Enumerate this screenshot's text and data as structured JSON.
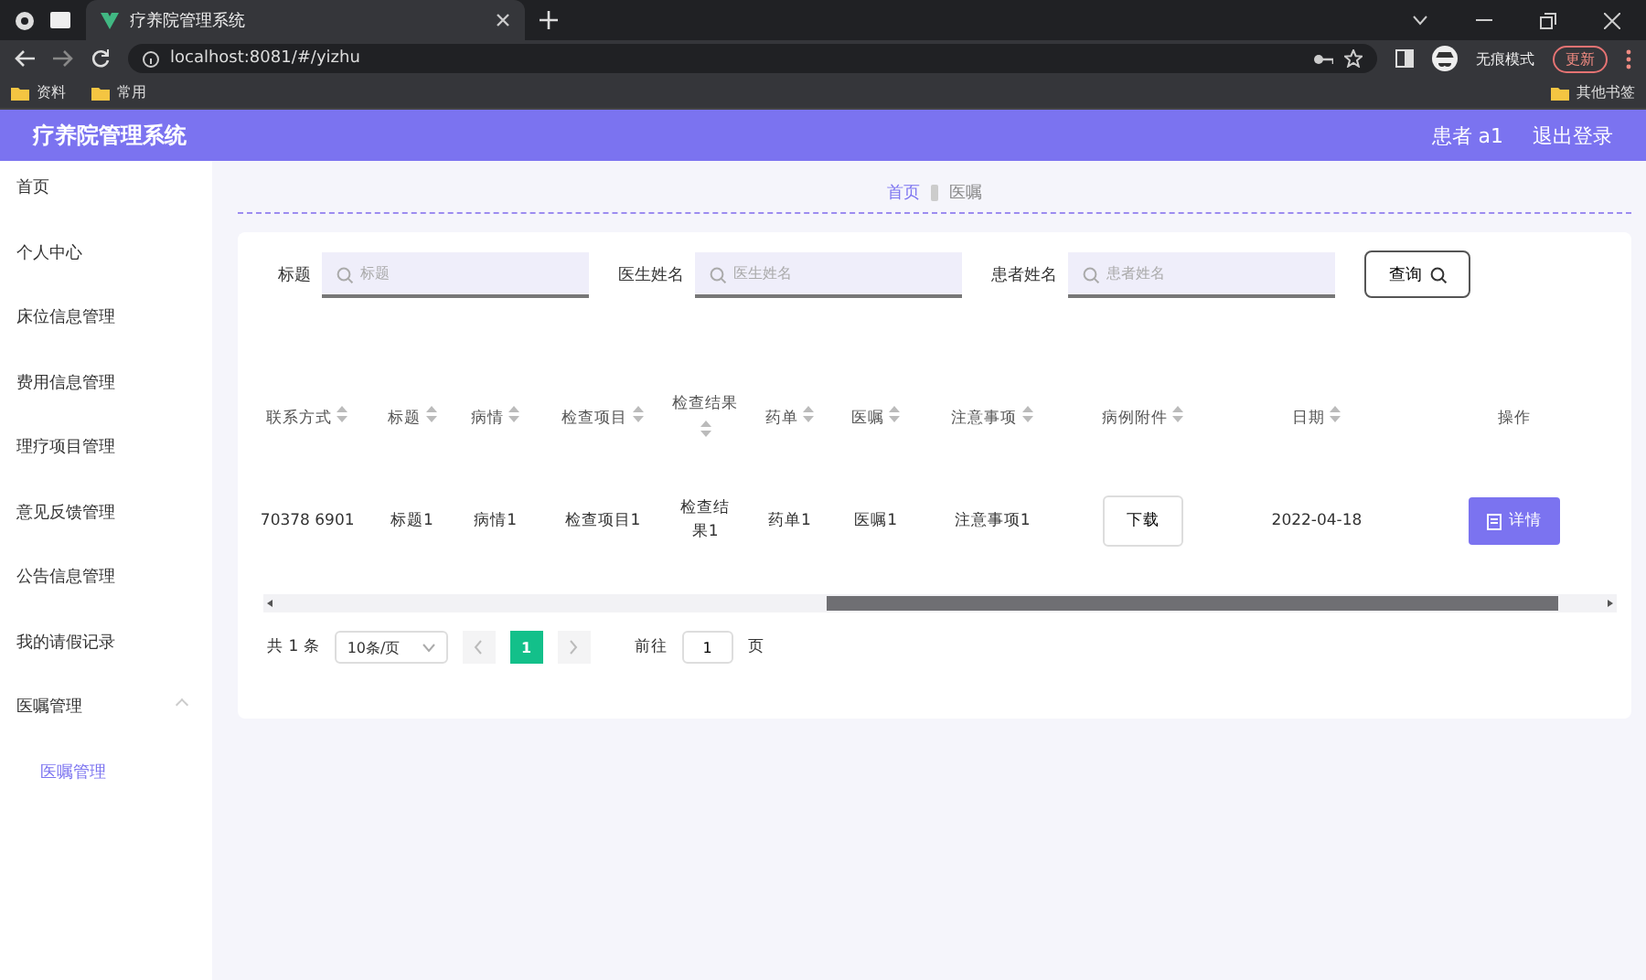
{
  "browser": {
    "tab_title": "疗养院管理系统",
    "url": "localhost:8081/#/yizhu",
    "incognito_label": "无痕模式",
    "update_button": "更新",
    "bookmarks": [
      "资料",
      "常用"
    ],
    "other_bookmarks": "其他书签"
  },
  "header": {
    "title": "疗养院管理系统",
    "user": "患者 a1",
    "logout": "退出登录"
  },
  "sidebar": {
    "items": [
      {
        "label": "首页",
        "selected": false
      },
      {
        "label": "个人中心",
        "selected": false
      },
      {
        "label": "床位信息管理",
        "selected": false
      },
      {
        "label": "费用信息管理",
        "selected": false
      },
      {
        "label": "理疗项目管理",
        "selected": false
      },
      {
        "label": "意见反馈管理",
        "selected": false
      },
      {
        "label": "公告信息管理",
        "selected": false
      },
      {
        "label": "我的请假记录",
        "selected": false
      },
      {
        "label": "医嘱管理",
        "selected": false,
        "expanded": true,
        "children": [
          {
            "label": "医嘱管理",
            "selected": true
          }
        ]
      }
    ]
  },
  "breadcrumb": [
    "首页",
    "医嘱"
  ],
  "search": {
    "fields": [
      {
        "label": "标题",
        "placeholder": "标题"
      },
      {
        "label": "医生姓名",
        "placeholder": "医生姓名"
      },
      {
        "label": "患者姓名",
        "placeholder": "患者姓名"
      }
    ],
    "button": "查询"
  },
  "table": {
    "columns": [
      {
        "label": "联系方式",
        "sortable": true
      },
      {
        "label": "标题",
        "sortable": true
      },
      {
        "label": "病情",
        "sortable": true
      },
      {
        "label": "检查项目",
        "sortable": true
      },
      {
        "label": "检查结果",
        "sortable": true
      },
      {
        "label": "药单",
        "sortable": true
      },
      {
        "label": "医嘱",
        "sortable": true
      },
      {
        "label": "注意事项",
        "sortable": true
      },
      {
        "label": "病例附件",
        "sortable": true
      },
      {
        "label": "日期",
        "sortable": true
      },
      {
        "label": "操作",
        "sortable": false
      }
    ],
    "rows": [
      {
        "cells": [
          {
            "kind": "text",
            "text": "70378 6901"
          },
          {
            "kind": "text",
            "text": "标题1"
          },
          {
            "kind": "text",
            "text": "病情1"
          },
          {
            "kind": "text",
            "text": "检查项目1"
          },
          {
            "kind": "text",
            "text": "检查结果1"
          },
          {
            "kind": "text",
            "text": "药单1"
          },
          {
            "kind": "text",
            "text": "医嘱1"
          },
          {
            "kind": "text",
            "text": "注意事项1"
          },
          {
            "kind": "download",
            "text": "下载"
          },
          {
            "kind": "text",
            "text": "2022-04-18"
          },
          {
            "kind": "action",
            "text": "详情"
          }
        ]
      }
    ]
  },
  "pagination": {
    "total": "共 1 条",
    "page_size": "10条/页",
    "pages": [
      {
        "label": "1",
        "selected": true
      }
    ],
    "goto_label": "前往",
    "goto_value": "1",
    "goto_suffix": "页"
  }
}
